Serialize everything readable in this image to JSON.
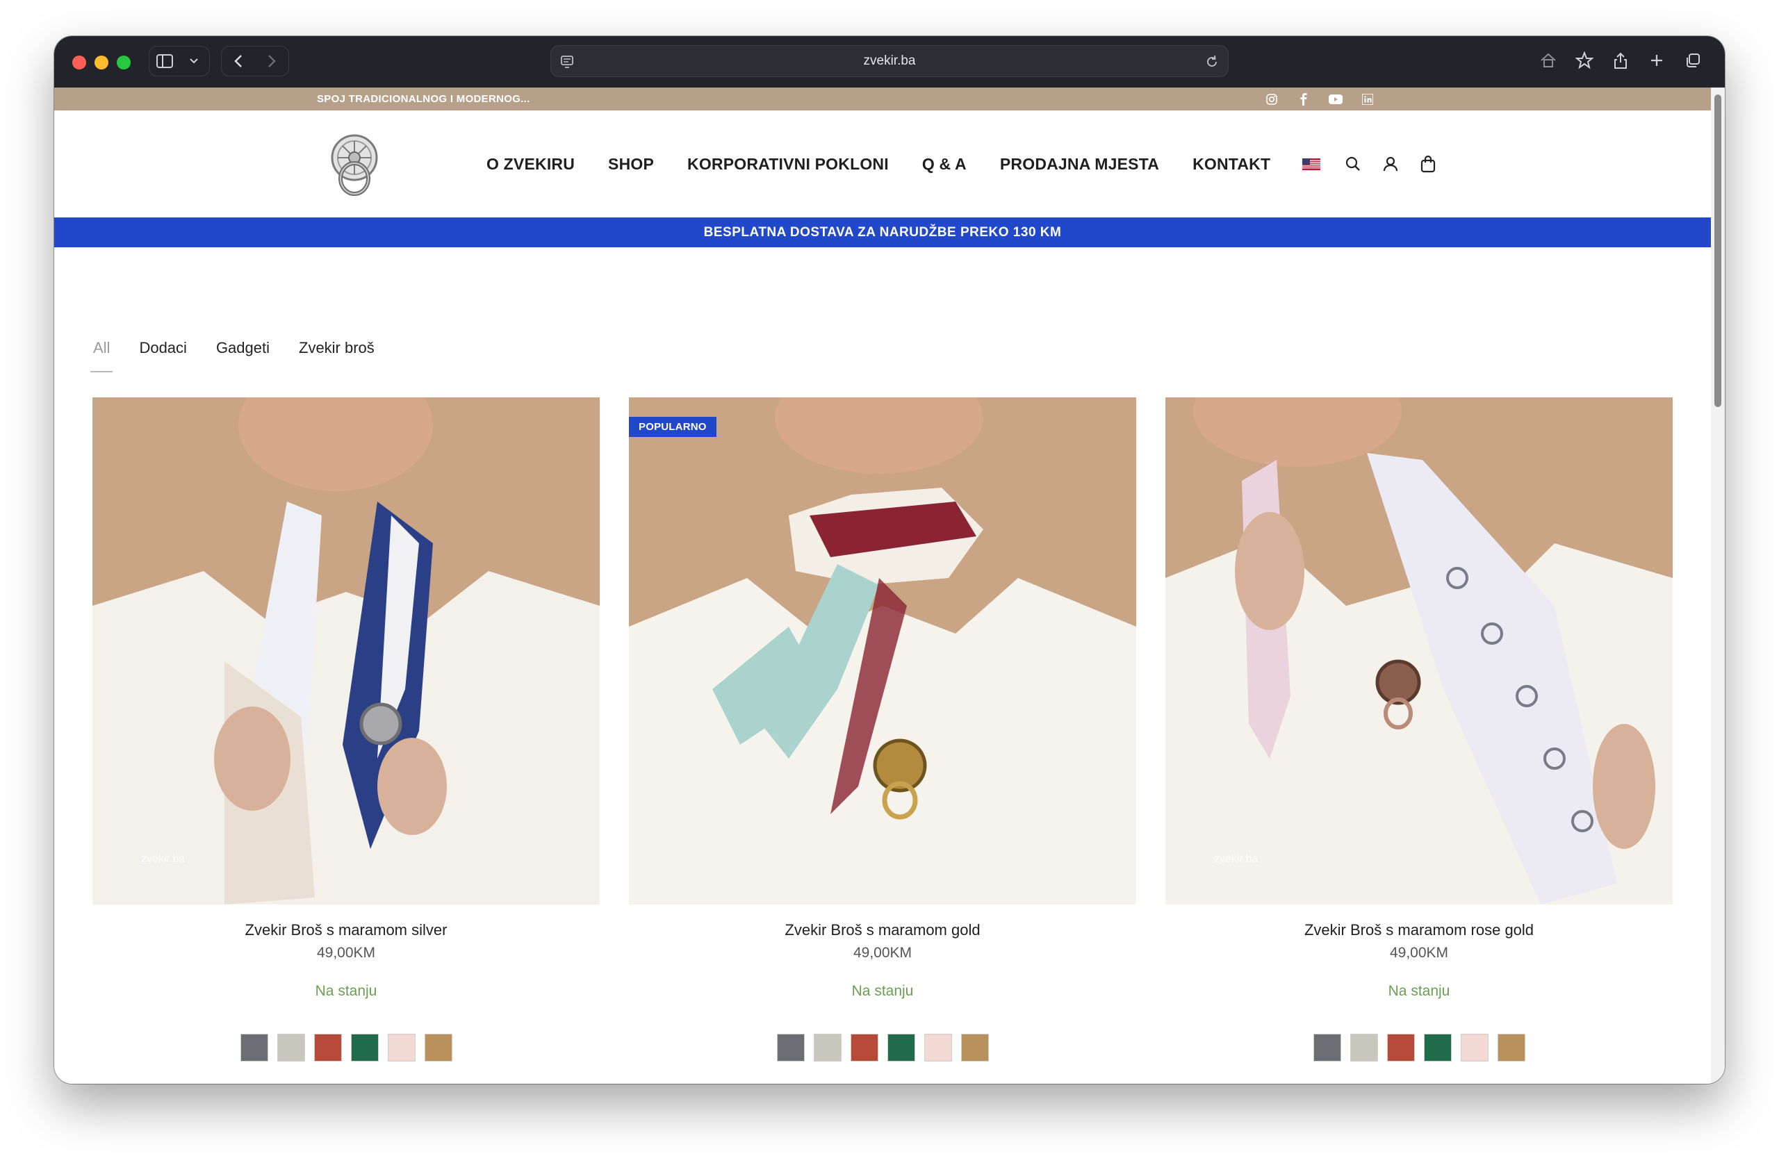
{
  "browser": {
    "url": "zvekir.ba"
  },
  "topbar": {
    "tagline": "SPOJ TRADICIONALNOG I MODERNOG...",
    "background": "#b6a08a",
    "socials": [
      "instagram-icon",
      "facebook-icon",
      "youtube-icon",
      "linkedin-icon"
    ]
  },
  "nav": {
    "items": [
      "O ZVEKIRU",
      "SHOP",
      "KORPORATIVNI POKLONI",
      "Q & A",
      "PRODAJNA MJESTA",
      "KONTAKT"
    ],
    "language_flag": "us-flag-icon",
    "icons": [
      "search-icon",
      "account-icon",
      "cart-icon"
    ]
  },
  "promo": {
    "text": "BESPLATNA DOSTAVA ZA NARUDŽBE PREKO 130 KM",
    "background": "#2148c9"
  },
  "filters": {
    "active": "All",
    "items": [
      "All",
      "Dodaci",
      "Gadgeti",
      "Zvekir broš"
    ]
  },
  "products": [
    {
      "name": "Zvekir Broš s maramom silver",
      "price": "49,00KM",
      "stock": "Na stanju",
      "watermark": "zvekir.ba",
      "badge": "",
      "swatch_colors": [
        "#6b6e72",
        "#c9c6be",
        "#b84a3a",
        "#1f6b4a",
        "#f3d9d4",
        "#b8915a"
      ]
    },
    {
      "name": "Zvekir Broš s maramom gold",
      "price": "49,00KM",
      "stock": "Na stanju",
      "watermark": "",
      "badge": "POPULARNO",
      "swatch_colors": [
        "#6b6e72",
        "#c9c6be",
        "#b84a3a",
        "#1f6b4a",
        "#f3d9d4",
        "#b8915a"
      ]
    },
    {
      "name": "Zvekir Broš s maramom rose gold",
      "price": "49,00KM",
      "stock": "Na stanju",
      "watermark": "zvekir.ba",
      "badge": "",
      "swatch_colors": [
        "#6b6e72",
        "#c9c6be",
        "#b84a3a",
        "#1f6b4a",
        "#f3d9d4",
        "#b8915a"
      ]
    }
  ],
  "colors": {
    "accent_blue": "#2148c9",
    "in_stock_green": "#6a9e4f",
    "photo_background": "#c9a485"
  }
}
